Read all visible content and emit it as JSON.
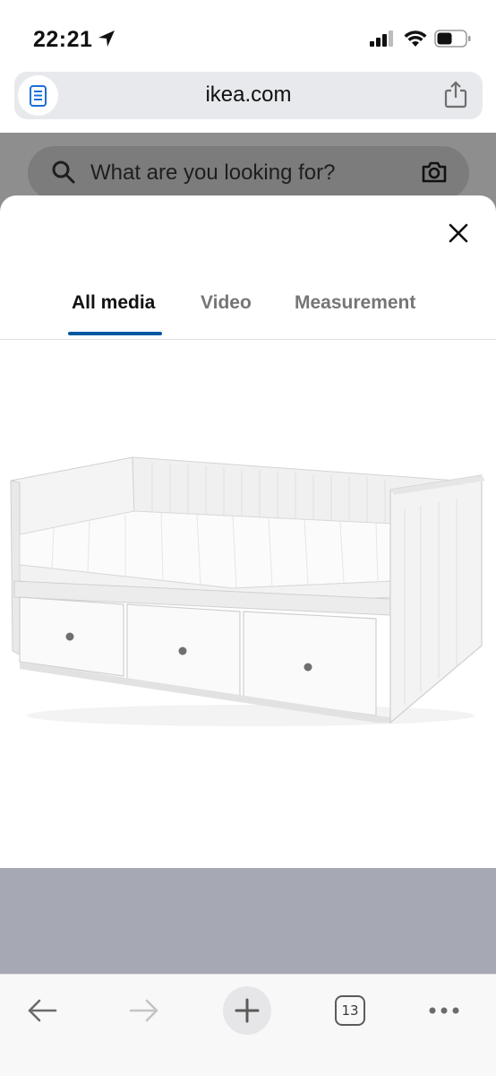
{
  "status_bar": {
    "time": "22:21",
    "icons": [
      "location-arrow-icon",
      "cellular-signal-icon",
      "wifi-icon",
      "battery-icon"
    ]
  },
  "browser": {
    "url": "ikea.com",
    "reader_icon": "reader-icon",
    "share_icon": "share-icon"
  },
  "page": {
    "search_placeholder": "What are you looking for?",
    "search_icon": "search-icon",
    "camera_icon": "camera-icon"
  },
  "modal": {
    "close_icon": "close-icon",
    "tabs": [
      {
        "label": "All media",
        "active": true
      },
      {
        "label": "Video",
        "active": false
      },
      {
        "label": "Measurement",
        "active": false
      }
    ],
    "accent_color": "#0058a3",
    "image_subject": "white daybed with three drawers"
  },
  "toolbar": {
    "back_icon": "back-arrow-icon",
    "forward_icon": "forward-arrow-icon",
    "new_tab_icon": "plus-icon",
    "tab_count": "13",
    "more_icon": "more-icon"
  }
}
